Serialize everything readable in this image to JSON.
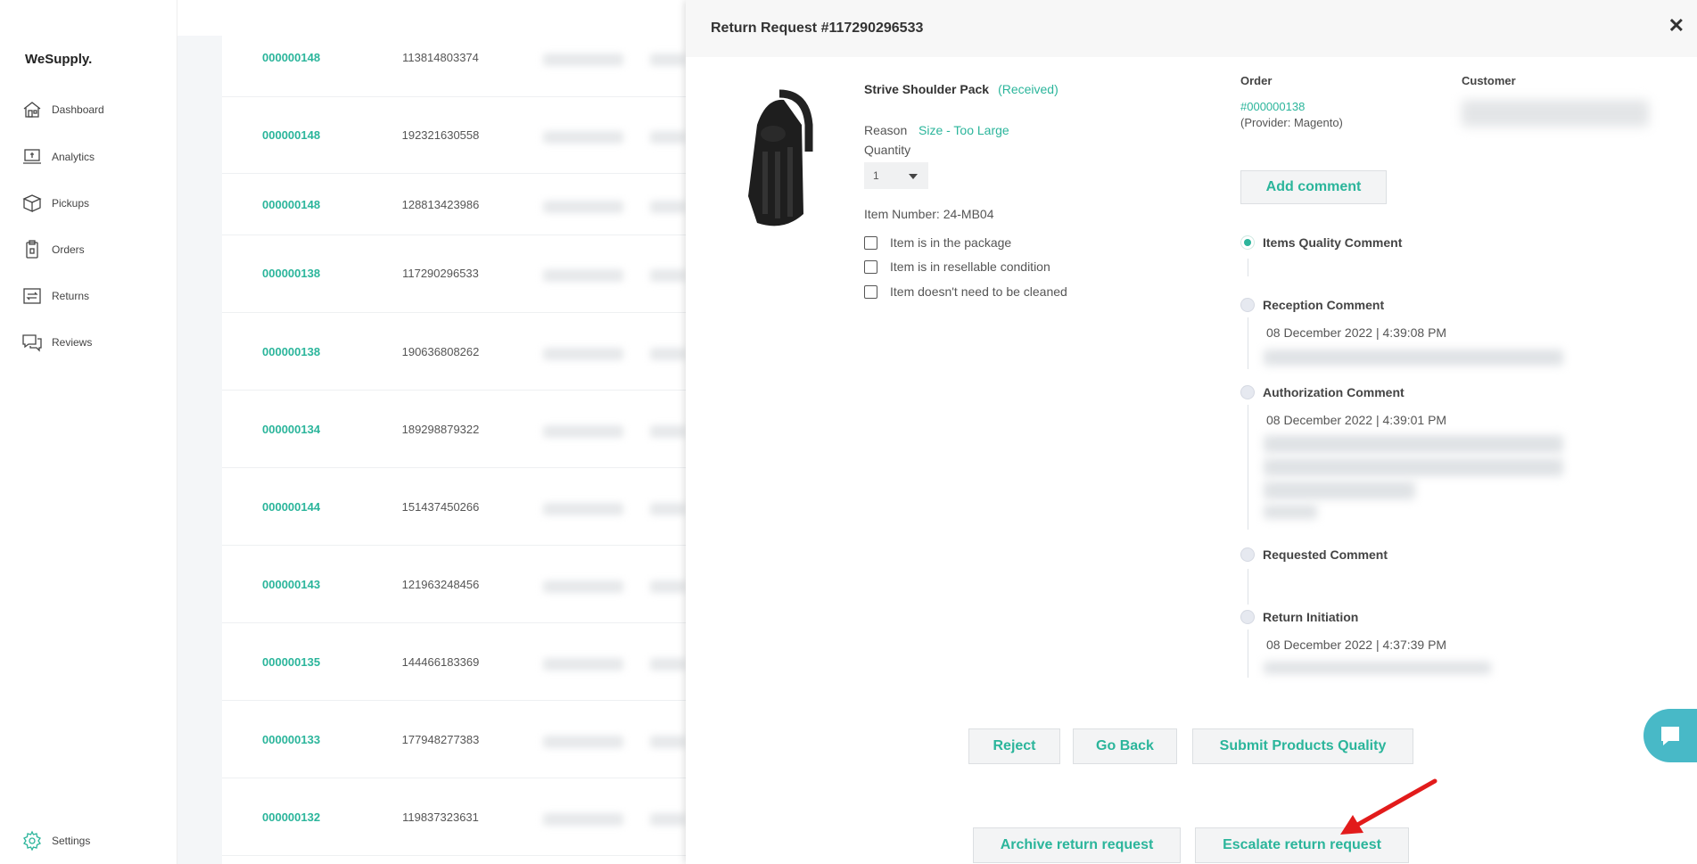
{
  "app": {
    "logo": "WeSupply."
  },
  "sidebar": {
    "items": [
      {
        "label": "Dashboard",
        "icon": "home-icon"
      },
      {
        "label": "Analytics",
        "icon": "analytics-icon"
      },
      {
        "label": "Pickups",
        "icon": "box-icon"
      },
      {
        "label": "Orders",
        "icon": "clipboard-icon"
      },
      {
        "label": "Returns",
        "icon": "returns-icon"
      },
      {
        "label": "Reviews",
        "icon": "chat-icon"
      }
    ],
    "settings_label": "Settings"
  },
  "list": {
    "rows": [
      {
        "order": "000000148",
        "number": "113814803374"
      },
      {
        "order": "000000148",
        "number": "192321630558"
      },
      {
        "order": "000000148",
        "number": "128813423986"
      },
      {
        "order": "000000138",
        "number": "117290296533"
      },
      {
        "order": "000000138",
        "number": "190636808262"
      },
      {
        "order": "000000134",
        "number": "189298879322"
      },
      {
        "order": "000000144",
        "number": "151437450266"
      },
      {
        "order": "000000143",
        "number": "121963248456"
      },
      {
        "order": "000000135",
        "number": "144466183369"
      },
      {
        "order": "000000133",
        "number": "177948277383"
      },
      {
        "order": "000000132",
        "number": "119837323631"
      }
    ]
  },
  "modal": {
    "title": "Return Request #117290296533",
    "close_label": "✕",
    "product": {
      "name": "Strive Shoulder Pack",
      "status": "(Received)",
      "reason_label": "Reason",
      "reason_value": "Size - Too Large",
      "quantity_label": "Quantity",
      "quantity_value": "1",
      "item_number": "Item Number: 24-MB04"
    },
    "checks": [
      "Item is in the package",
      "Item is in resellable condition",
      "Item doesn't need to be cleaned"
    ],
    "order_label": "Order",
    "order_link": "#000000138",
    "order_provider": "(Provider: Magento)",
    "customer_label": "Customer",
    "add_comment": "Add comment",
    "timeline": [
      {
        "title": "Items Quality Comment",
        "date": ""
      },
      {
        "title": "Reception Comment",
        "date": "08 December 2022 | 4:39:08 PM"
      },
      {
        "title": "Authorization Comment",
        "date": "08 December 2022 | 4:39:01 PM"
      },
      {
        "title": "Requested Comment",
        "date": ""
      },
      {
        "title": "Return Initiation",
        "date": "08 December 2022 | 4:37:39 PM"
      }
    ],
    "buttons": {
      "reject": "Reject",
      "go_back": "Go Back",
      "submit_quality": "Submit Products Quality",
      "archive": "Archive return request",
      "escalate": "Escalate return request"
    }
  },
  "colors": {
    "accent": "#2bb59b",
    "chat": "#48b9c7",
    "arrow": "#e21b1b"
  }
}
